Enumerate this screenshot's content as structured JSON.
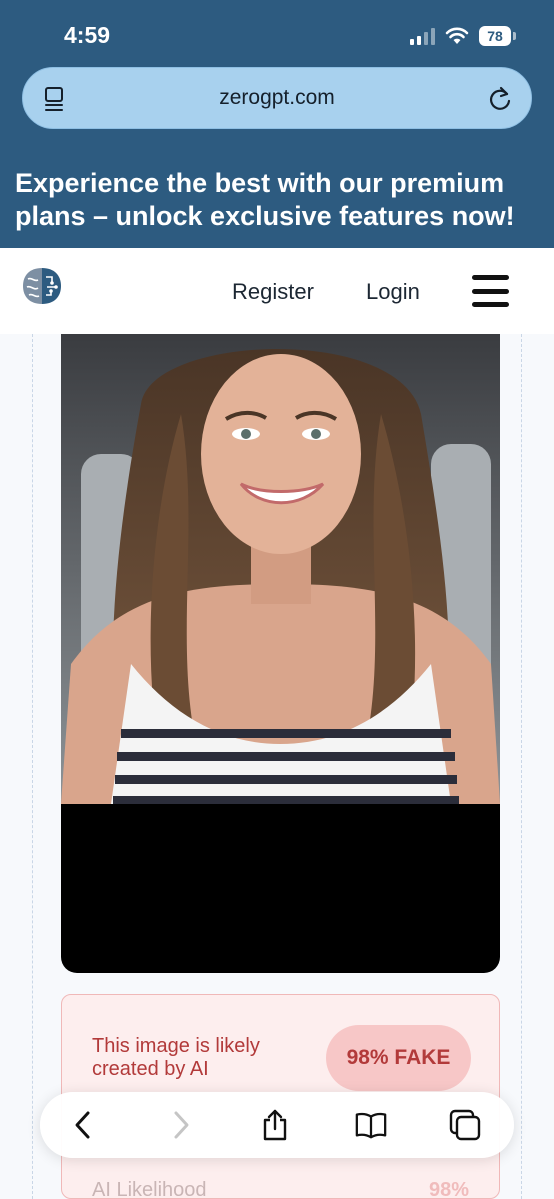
{
  "status": {
    "time": "4:59",
    "battery": "78"
  },
  "browser": {
    "url": "zerogpt.com"
  },
  "promo": {
    "line1": "Experience the best with our premium",
    "line2": "plans – unlock exclusive features now!"
  },
  "nav": {
    "register": "Register",
    "login": "Login"
  },
  "result": {
    "message_line1": "This image is likely",
    "message_line2": "created by AI",
    "badge": "98% FAKE",
    "likelihood_label": "AI Likelihood",
    "likelihood_value": "98%"
  },
  "colors": {
    "brand": "#2d5b80",
    "url_bar": "#a8d1ee",
    "fake_red": "#b23a3a",
    "card_bg": "#fdeeee"
  },
  "icons": [
    "tab-overview-icon",
    "reload-icon",
    "back-icon",
    "forward-icon",
    "share-icon",
    "bookmarks-icon",
    "tabs-icon",
    "brain-logo-icon",
    "hamburger-menu-icon"
  ]
}
